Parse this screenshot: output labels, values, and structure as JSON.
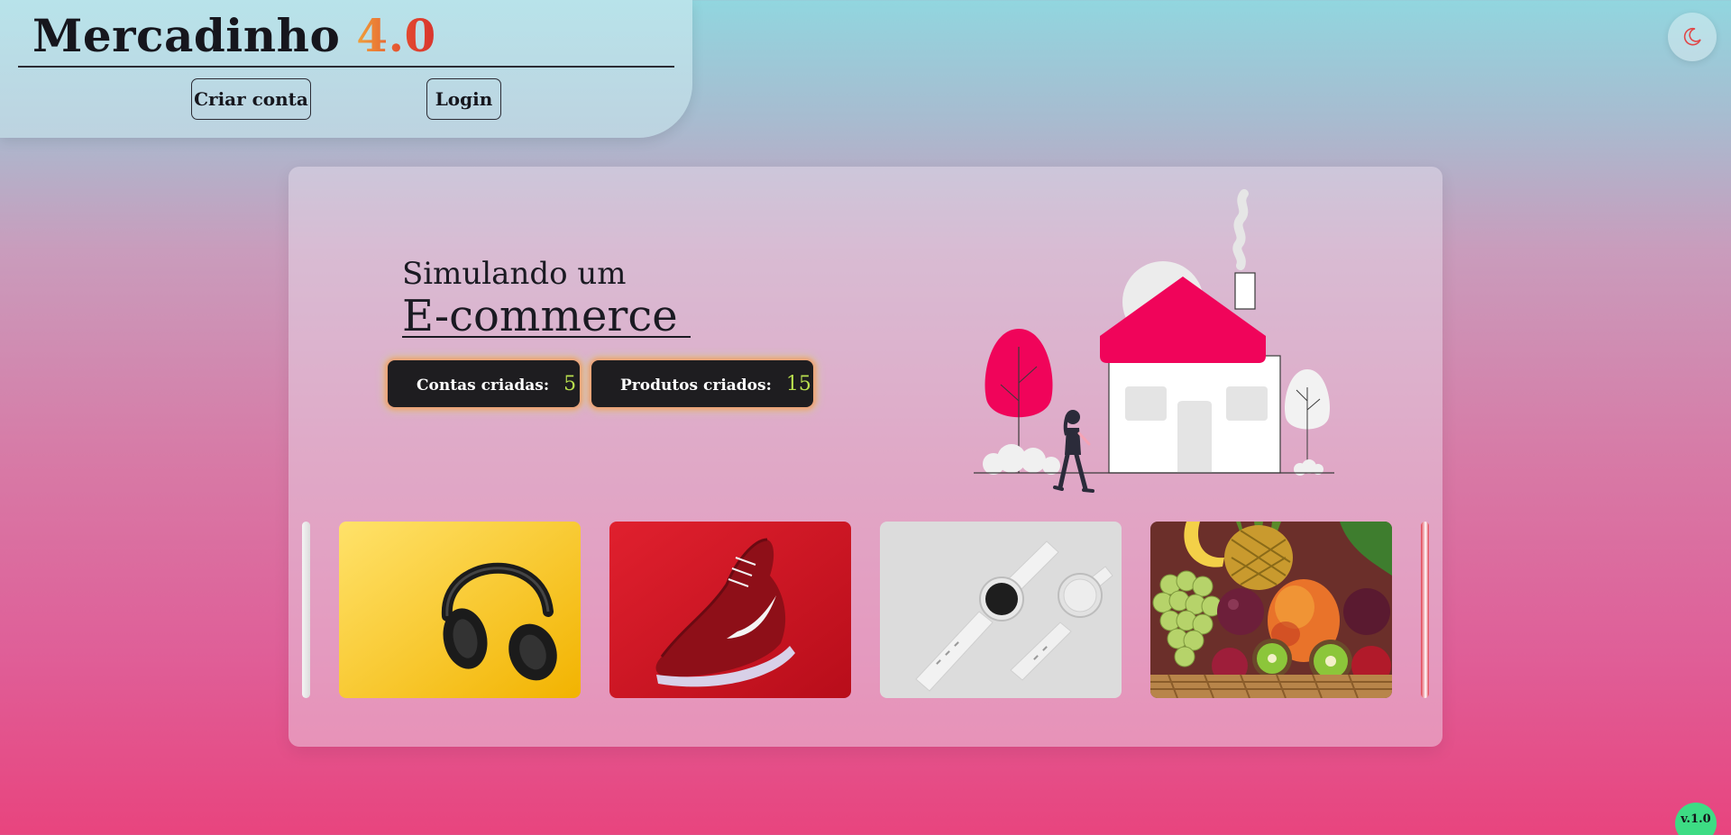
{
  "header": {
    "brand_name": "Mercadinho",
    "brand_version": "4.0",
    "create_account_label": "Criar conta",
    "login_label": "Login"
  },
  "theme_toggle": {
    "icon": "moon-icon",
    "color": "#e04848"
  },
  "hero": {
    "line1": "Simulando um",
    "line2": "E-commerce"
  },
  "stats": [
    {
      "label": "Contas criadas:",
      "value": "5"
    },
    {
      "label": "Produtos criados:",
      "value": "15"
    }
  ],
  "carousel": {
    "slides": [
      {
        "icon": "headphones-image",
        "background": "#f6c21a"
      },
      {
        "icon": "sneaker-image",
        "background": "#c8101e"
      },
      {
        "icon": "smartwatch-image",
        "background": "#dcdcdc"
      },
      {
        "icon": "fruits-image",
        "background": "#7a3a2a"
      }
    ]
  },
  "version_badge": "v.1.0",
  "colors": {
    "accent_pink": "#f0045a",
    "badge_green": "#3ddc84",
    "stat_value": "#b9df4e"
  }
}
